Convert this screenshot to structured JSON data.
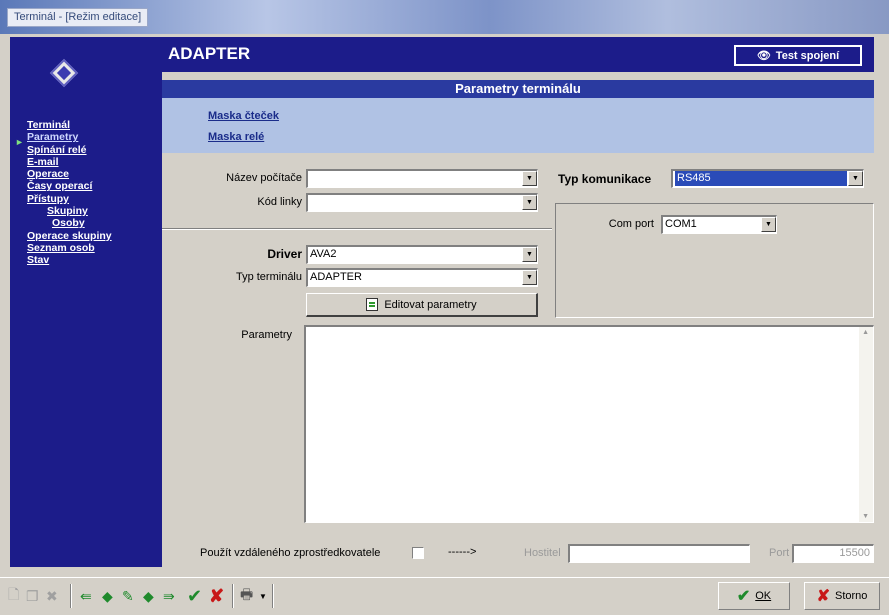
{
  "window": {
    "title": "Terminál - [Režim editace]"
  },
  "header": {
    "title": "ADAPTER",
    "test_button": "Test spojení"
  },
  "sidebar": {
    "items": [
      {
        "label": "Terminál"
      },
      {
        "label": "Parametry"
      },
      {
        "label": "Spínání relé"
      },
      {
        "label": "E-mail"
      },
      {
        "label": "Operace"
      },
      {
        "label": "Časy operací"
      },
      {
        "label": "Přístupy"
      },
      {
        "label": "Skupiny"
      },
      {
        "label": "Osoby"
      },
      {
        "label": "Operace skupiny"
      },
      {
        "label": "Seznam osob"
      },
      {
        "label": "Stav"
      }
    ]
  },
  "section": {
    "title": "Parametry terminálu",
    "mask_readers": "Maska čteček",
    "mask_relay": "Maska relé"
  },
  "form": {
    "computer_name_label": "Název počítače",
    "computer_name_value": "",
    "line_code_label": "Kód linky",
    "line_code_value": "",
    "driver_label": "Driver",
    "driver_value": "AVA2",
    "terminal_type_label": "Typ terminálu",
    "terminal_type_value": "ADAPTER",
    "edit_params_button": "Editovat parametry",
    "params_label": "Parametry",
    "params_value": "",
    "comm_type_label": "Typ komunikace",
    "comm_type_value": "RS485",
    "com_port_label": "Com port",
    "com_port_value": "COM1"
  },
  "bottom": {
    "remote_label": "Použít vzdáleného zprostředkovatele",
    "arrow": "------>",
    "host_label": "Hostitel",
    "host_value": "",
    "port_label": "Port",
    "port_value": "15500"
  },
  "toolbar": {
    "ok_label": "OK",
    "storno_label": "Storno"
  }
}
